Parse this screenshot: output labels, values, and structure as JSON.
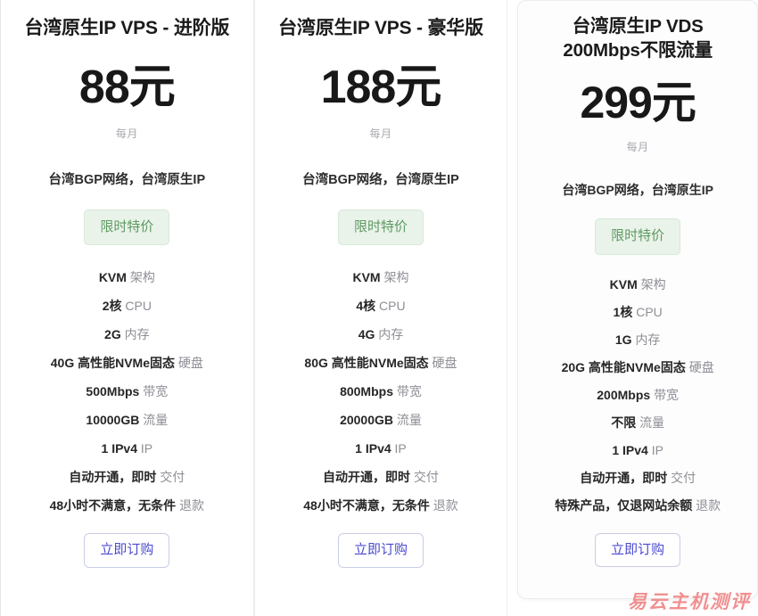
{
  "watermark": "易云主机测评",
  "plans": [
    {
      "id": "vps-advanced",
      "featured": false,
      "title": "台湾原生IP VPS - 进阶版",
      "price": "88元",
      "period": "每月",
      "network": "台湾BGP网络，台湾原生IP",
      "badge": "限时特价",
      "specs": [
        {
          "value": "KVM",
          "label": "架构"
        },
        {
          "value": "2核",
          "label": "CPU"
        },
        {
          "value": "2G",
          "label": "内存"
        },
        {
          "value": "40G 高性能NVMe固态",
          "label": "硬盘"
        },
        {
          "value": "500Mbps",
          "label": "带宽"
        },
        {
          "value": "10000GB",
          "label": "流量"
        },
        {
          "value": "1 IPv4",
          "label": "IP"
        },
        {
          "value": "自动开通，即时",
          "label": "交付"
        },
        {
          "value": "48小时不满意，无条件",
          "label": "退款"
        }
      ],
      "order_label": "立即订购"
    },
    {
      "id": "vps-deluxe",
      "featured": false,
      "title": "台湾原生IP VPS - 豪华版",
      "price": "188元",
      "period": "每月",
      "network": "台湾BGP网络，台湾原生IP",
      "badge": "限时特价",
      "specs": [
        {
          "value": "KVM",
          "label": "架构"
        },
        {
          "value": "4核",
          "label": "CPU"
        },
        {
          "value": "4G",
          "label": "内存"
        },
        {
          "value": "80G 高性能NVMe固态",
          "label": "硬盘"
        },
        {
          "value": "800Mbps",
          "label": "带宽"
        },
        {
          "value": "20000GB",
          "label": "流量"
        },
        {
          "value": "1 IPv4",
          "label": "IP"
        },
        {
          "value": "自动开通，即时",
          "label": "交付"
        },
        {
          "value": "48小时不满意，无条件",
          "label": "退款"
        }
      ],
      "order_label": "立即订购"
    },
    {
      "id": "vds-unlimited",
      "featured": true,
      "title": "台湾原生IP VDS 200Mbps不限流量",
      "price": "299元",
      "period": "每月",
      "network": "台湾BGP网络，台湾原生IP",
      "badge": "限时特价",
      "specs": [
        {
          "value": "KVM",
          "label": "架构"
        },
        {
          "value": "1核",
          "label": "CPU"
        },
        {
          "value": "1G",
          "label": "内存"
        },
        {
          "value": "20G 高性能NVMe固态",
          "label": "硬盘"
        },
        {
          "value": "200Mbps",
          "label": "带宽"
        },
        {
          "value": "不限",
          "label": "流量"
        },
        {
          "value": "1 IPv4",
          "label": "IP"
        },
        {
          "value": "自动开通，即时",
          "label": "交付"
        },
        {
          "value": "特殊产品，仅退网站余额",
          "label": "退款"
        }
      ],
      "order_label": "立即订购"
    }
  ],
  "colors": {
    "badge_text": "#5f9a62",
    "badge_bg": "#e9f3ea",
    "badge_border": "#d7e8d8",
    "order_text": "#4a4ad0",
    "order_border": "#c9cde4",
    "price_text": "#181818",
    "spec_value": "#262626",
    "spec_label": "#8e8e96",
    "period_text": "#a9a9b0",
    "watermark": "#f08b8b"
  }
}
